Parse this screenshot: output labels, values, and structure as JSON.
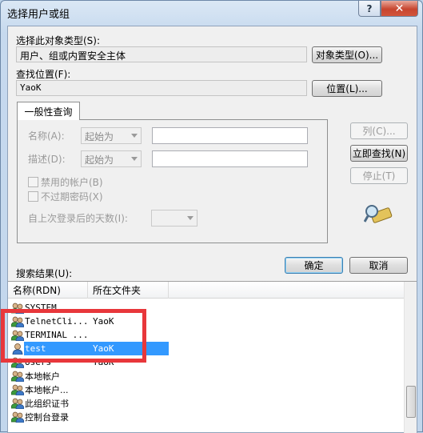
{
  "window": {
    "title": "选择用户或组",
    "help_glyph": "?",
    "close_glyph": "✕"
  },
  "object_type": {
    "label": "选择此对象类型(S):",
    "value": "用户、组或内置安全主体",
    "button": "对象类型(O)..."
  },
  "location": {
    "label": "查找位置(F):",
    "value": "YaoK",
    "button": "位置(L)..."
  },
  "query": {
    "tab": "一般性查询",
    "name_label": "名称(A):",
    "name_mode": "起始为",
    "desc_label": "描述(D):",
    "desc_mode": "起始为",
    "disabled_accounts": "禁用的帐户(B)",
    "non_expiring_pw": "不过期密码(X)",
    "days_since_logon": "自上次登录后的天数(I):"
  },
  "side_buttons": {
    "columns": "列(C)...",
    "find_now": "立即查找(N)",
    "stop": "停止(T)"
  },
  "footer": {
    "results_label": "搜索结果(U):",
    "ok": "确定",
    "cancel": "取消"
  },
  "results": {
    "columns": [
      "名称(RDN)",
      "所在文件夹"
    ],
    "rows": [
      {
        "name": "SYSTEM",
        "folder": "",
        "icon": "group-icon"
      },
      {
        "name": "TelnetCli...",
        "folder": "YaoK",
        "icon": "group-icon"
      },
      {
        "name": "TERMINAL ...",
        "folder": "",
        "icon": "group-icon"
      },
      {
        "name": "test",
        "folder": "YaoK",
        "icon": "user-icon",
        "selected": true
      },
      {
        "name": "Users",
        "folder": "YaoK",
        "icon": "group-icon"
      },
      {
        "name": "本地帐户",
        "folder": "",
        "icon": "group-icon"
      },
      {
        "name": "本地帐户...",
        "folder": "",
        "icon": "group-icon"
      },
      {
        "name": "此组织证书",
        "folder": "",
        "icon": "group-icon"
      },
      {
        "name": "控制台登录",
        "folder": "",
        "icon": "group-icon"
      }
    ]
  }
}
